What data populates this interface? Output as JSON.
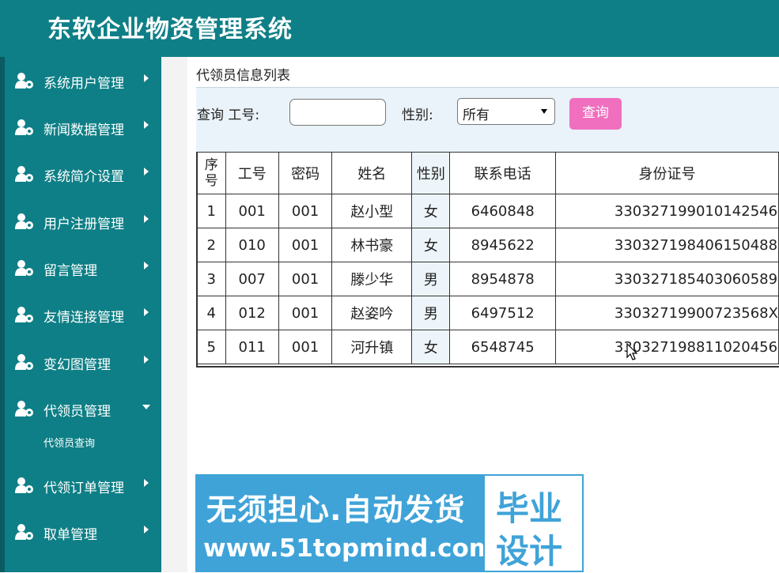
{
  "app": {
    "title": "东软企业物资管理系统"
  },
  "sidebar": {
    "items": [
      {
        "label": "系统用户管理",
        "icon": "user-gear-icon",
        "expanded": false
      },
      {
        "label": "新闻数据管理",
        "icon": "user-gear-icon",
        "expanded": false
      },
      {
        "label": "系统简介设置",
        "icon": "user-gear-icon",
        "expanded": false
      },
      {
        "label": "用户注册管理",
        "icon": "user-gear-icon",
        "expanded": false
      },
      {
        "label": "留言管理",
        "icon": "user-gear-icon",
        "expanded": false
      },
      {
        "label": "友情连接管理",
        "icon": "user-gear-icon",
        "expanded": false
      },
      {
        "label": "变幻图管理",
        "icon": "user-gear-icon",
        "expanded": false
      },
      {
        "label": "代领员管理",
        "icon": "user-gear-icon",
        "expanded": true
      },
      {
        "label": "代领订单管理",
        "icon": "user-gear-icon",
        "expanded": false
      },
      {
        "label": "取单管理",
        "icon": "user-gear-icon",
        "expanded": false
      }
    ],
    "submenu": {
      "label": "代领员查询"
    }
  },
  "main": {
    "panel_title": "代领员信息列表",
    "search": {
      "query_label": "查询 工号:",
      "employee_id_value": "",
      "gender_label": "性别:",
      "gender_selected": "所有",
      "search_button": "查询"
    },
    "table": {
      "headers": [
        "序号",
        "工号",
        "密码",
        "姓名",
        "性别",
        "联系电话",
        "身份证号"
      ],
      "rows": [
        [
          "1",
          "001",
          "001",
          "赵小型",
          "女",
          "6460848",
          "330327199010142546"
        ],
        [
          "2",
          "010",
          "001",
          "林书豪",
          "女",
          "8945622",
          "330327198406150488"
        ],
        [
          "3",
          "007",
          "001",
          "滕少华",
          "男",
          "8954878",
          "330327185403060589"
        ],
        [
          "4",
          "012",
          "001",
          "赵姿吟",
          "男",
          "6497512",
          "33032719900723568X"
        ],
        [
          "5",
          "011",
          "001",
          "河升镇",
          "女",
          "6548745",
          "330327198811020456"
        ]
      ]
    }
  },
  "watermark": {
    "line1": "无须担心.自动发货",
    "line2": "www.51topmind.com",
    "box_line1": "毕业",
    "box_line2": "设计"
  },
  "colors": {
    "header_bg": "#0e7f86",
    "sidebar_bg": "#0e7f86",
    "search_button_bg": "#f06fbf",
    "search_bar_bg": "#eaf3fa",
    "watermark_bg": "#3fa3d8"
  }
}
